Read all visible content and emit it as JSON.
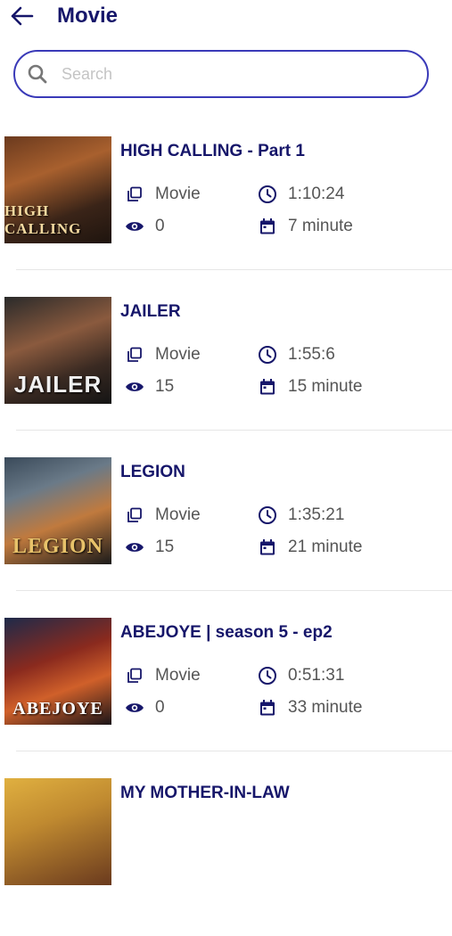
{
  "header": {
    "title": "Movie"
  },
  "search": {
    "placeholder": "Search",
    "value": ""
  },
  "movies": [
    {
      "title": "HIGH CALLING - Part 1",
      "type": "Movie",
      "duration": "1:10:24",
      "views": "0",
      "date": "7 minute",
      "poster_text": "HIGH CALLING"
    },
    {
      "title": "JAILER",
      "type": "Movie",
      "duration": "1:55:6",
      "views": "15",
      "date": "15 minute",
      "poster_text": "JAILER"
    },
    {
      "title": "LEGION",
      "type": "Movie",
      "duration": "1:35:21",
      "views": "15",
      "date": "21 minute",
      "poster_text": "LEGION"
    },
    {
      "title": "ABEJOYE | season 5 - ep2",
      "type": "Movie",
      "duration": "0:51:31",
      "views": "0",
      "date": "33 minute",
      "poster_text": "ABEJOYE"
    },
    {
      "title": "MY MOTHER-IN-LAW",
      "type": "",
      "duration": "",
      "views": "",
      "date": "",
      "poster_text": ""
    }
  ],
  "colors": {
    "accent": "#16166a",
    "search_border": "#3a3ab8",
    "meta_text": "#555555"
  },
  "icons": {
    "back": "arrow-left-icon",
    "search": "search-icon",
    "type": "library-icon",
    "duration": "clock-icon",
    "views": "eye-icon",
    "date": "calendar-icon"
  }
}
